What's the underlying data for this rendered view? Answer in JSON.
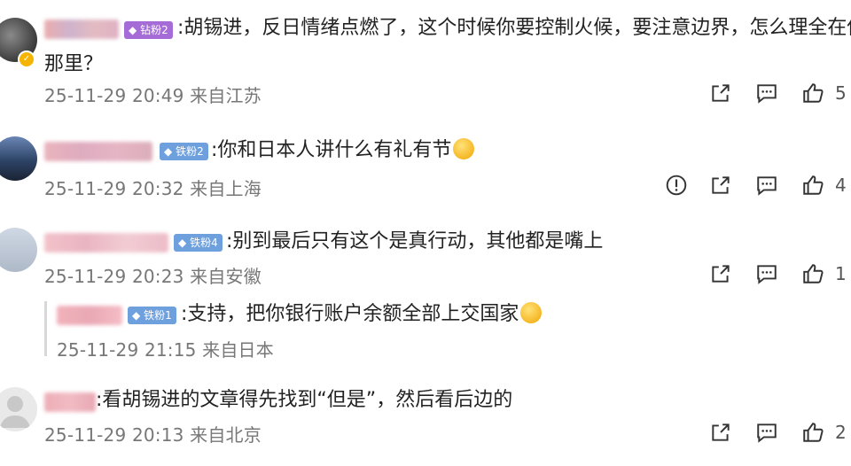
{
  "comments": [
    {
      "badge": "钻粉2",
      "text_line1": ":胡锡进，反日情绪点燃了，这个时候你要控制火候，要注意边界，怎么理全在你",
      "text_line2": "那里？",
      "meta": "25-11-29 20:49 来自江苏",
      "likes": "5"
    },
    {
      "badge": "铁粉2",
      "text": ":你和日本人讲什么有礼有节",
      "meta": "25-11-29 20:32 来自上海",
      "likes": "4"
    },
    {
      "badge": "铁粉4",
      "text": ":别到最后只有这个是真行动，其他都是嘴上",
      "meta": "25-11-29 20:23 来自安徽",
      "likes": "1"
    },
    {
      "badge": "铁粉1",
      "text": ":支持，把你银行账户余额全部上交国家",
      "meta": "25-11-29 21:15 来自日本"
    },
    {
      "text": ":看胡锡进的文章得先找到“但是”，然后看后边的",
      "meta": "25-11-29 20:13 来自北京",
      "likes": "2"
    }
  ],
  "colors": {
    "badge_purple": "#a56bd6",
    "badge_blue": "#6fa0de",
    "meta_gray": "#777777"
  },
  "icons": [
    "share-icon",
    "comment-icon",
    "like-icon",
    "report-icon",
    "vip-badge-icon",
    "diamond-icon",
    "emoji"
  ]
}
